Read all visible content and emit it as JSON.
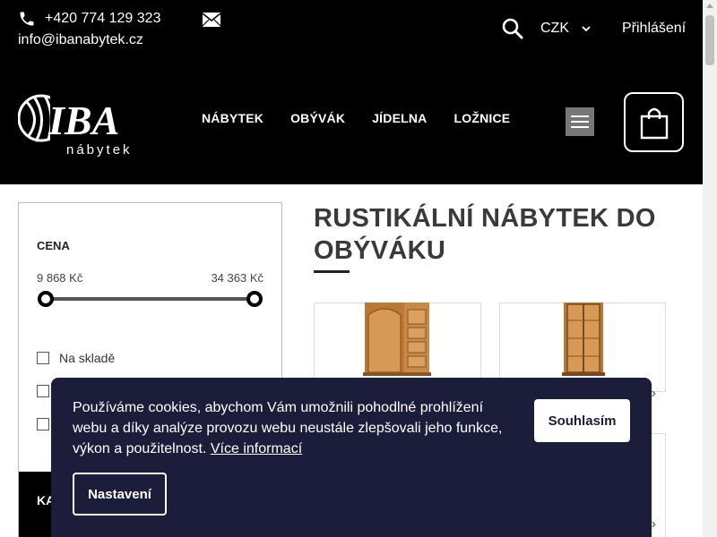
{
  "topbar": {
    "phone": "+420 774 129 323",
    "email": "info@ibanabytek.cz",
    "currency": "CZK",
    "login": "Přihlášení",
    "icons": [
      "phone-icon",
      "mail-icon",
      "search-icon",
      "chevron-down-icon"
    ]
  },
  "header": {
    "logo_text": "IBA",
    "logo_subtext": "nábytek",
    "nav": [
      "NÁBYTEK",
      "OBÝVÁK",
      "JÍDELNA",
      "LOŽNICE"
    ],
    "icons": [
      "menu-icon",
      "cart-icon"
    ]
  },
  "filter": {
    "title": "CENA",
    "price_min": "9 868 Kč",
    "price_max": "34 363 Kč",
    "in_stock_label": "Na skladě",
    "category_label": "KA"
  },
  "main": {
    "title": "RUSTIKÁLNÍ NÁBYTEK DO OBÝVÁKU",
    "product_arrow": "›"
  },
  "cookie": {
    "text": "Používáme cookies, abychom Vám umožnili pohodlné prohlížení webu a díky analýze provozu webu neustále zlepšovali jeho funkce, výkon a použitelnost.",
    "link": "Více informací",
    "agree_button": "Souhlasím",
    "settings_button": "Nastavení"
  },
  "colors": {
    "header_bg": "#000000",
    "cookie_bg": "#1c1d3a",
    "wood": "#c98a45"
  }
}
